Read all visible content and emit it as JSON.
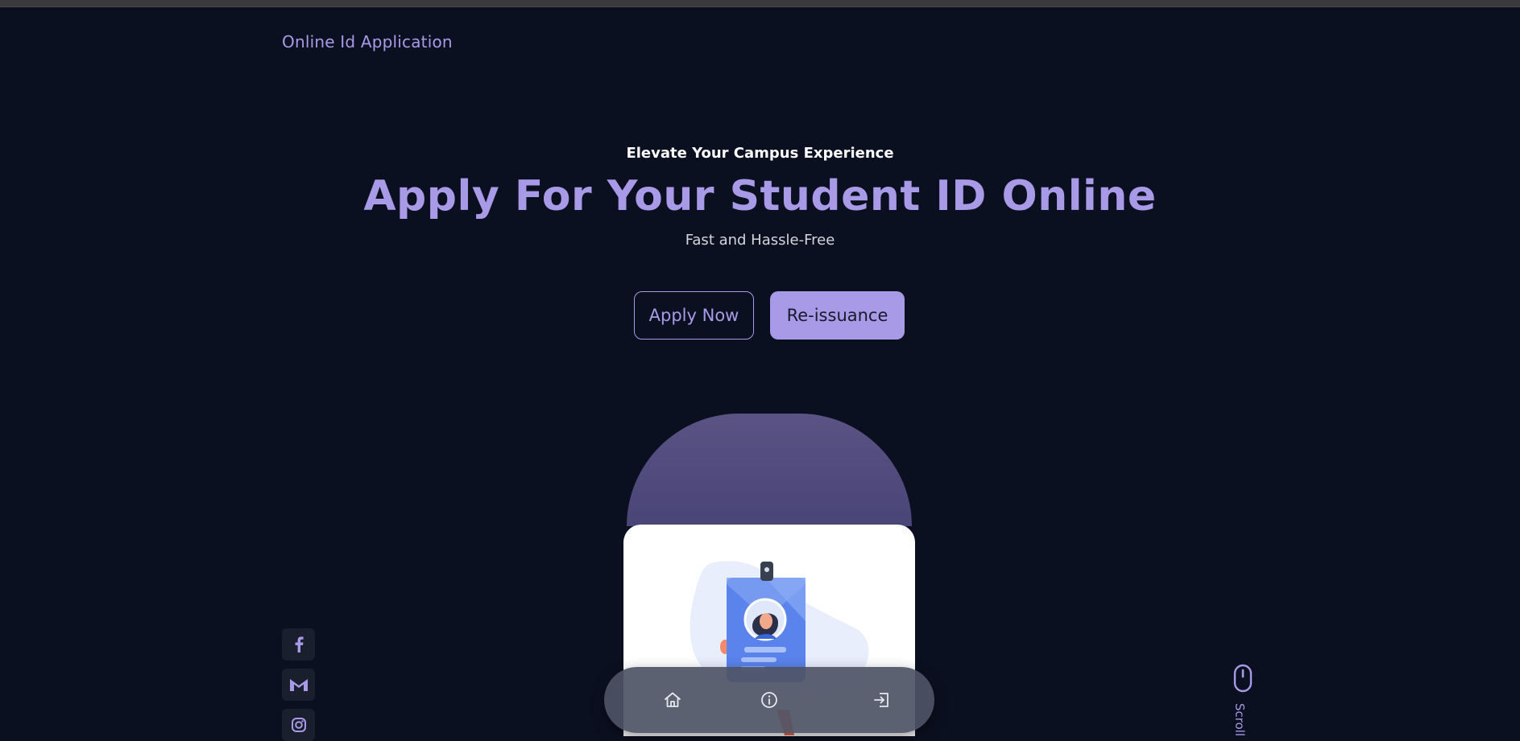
{
  "header": {
    "brand": "Online Id Application"
  },
  "hero": {
    "eyebrow": "Elevate Your Campus Experience",
    "title": "Apply For Your Student ID Online",
    "tagline": "Fast and Hassle-Free",
    "primary_button": "Apply Now",
    "secondary_button": "Re-issuance"
  },
  "social": [
    {
      "icon": "facebook-icon"
    },
    {
      "icon": "gmail-icon"
    },
    {
      "icon": "instagram-icon"
    }
  ],
  "bottom_nav": [
    {
      "icon": "home-icon"
    },
    {
      "icon": "info-icon"
    },
    {
      "icon": "login-icon"
    }
  ],
  "scroll_hint": {
    "icon": "mouse-icon",
    "label": "Scroll Down"
  },
  "colors": {
    "background": "#0b1020",
    "accent": "#a99ae8",
    "arch": "#554f80",
    "social_bg": "#1a1f2e",
    "nav_bg": "#4e5466"
  }
}
